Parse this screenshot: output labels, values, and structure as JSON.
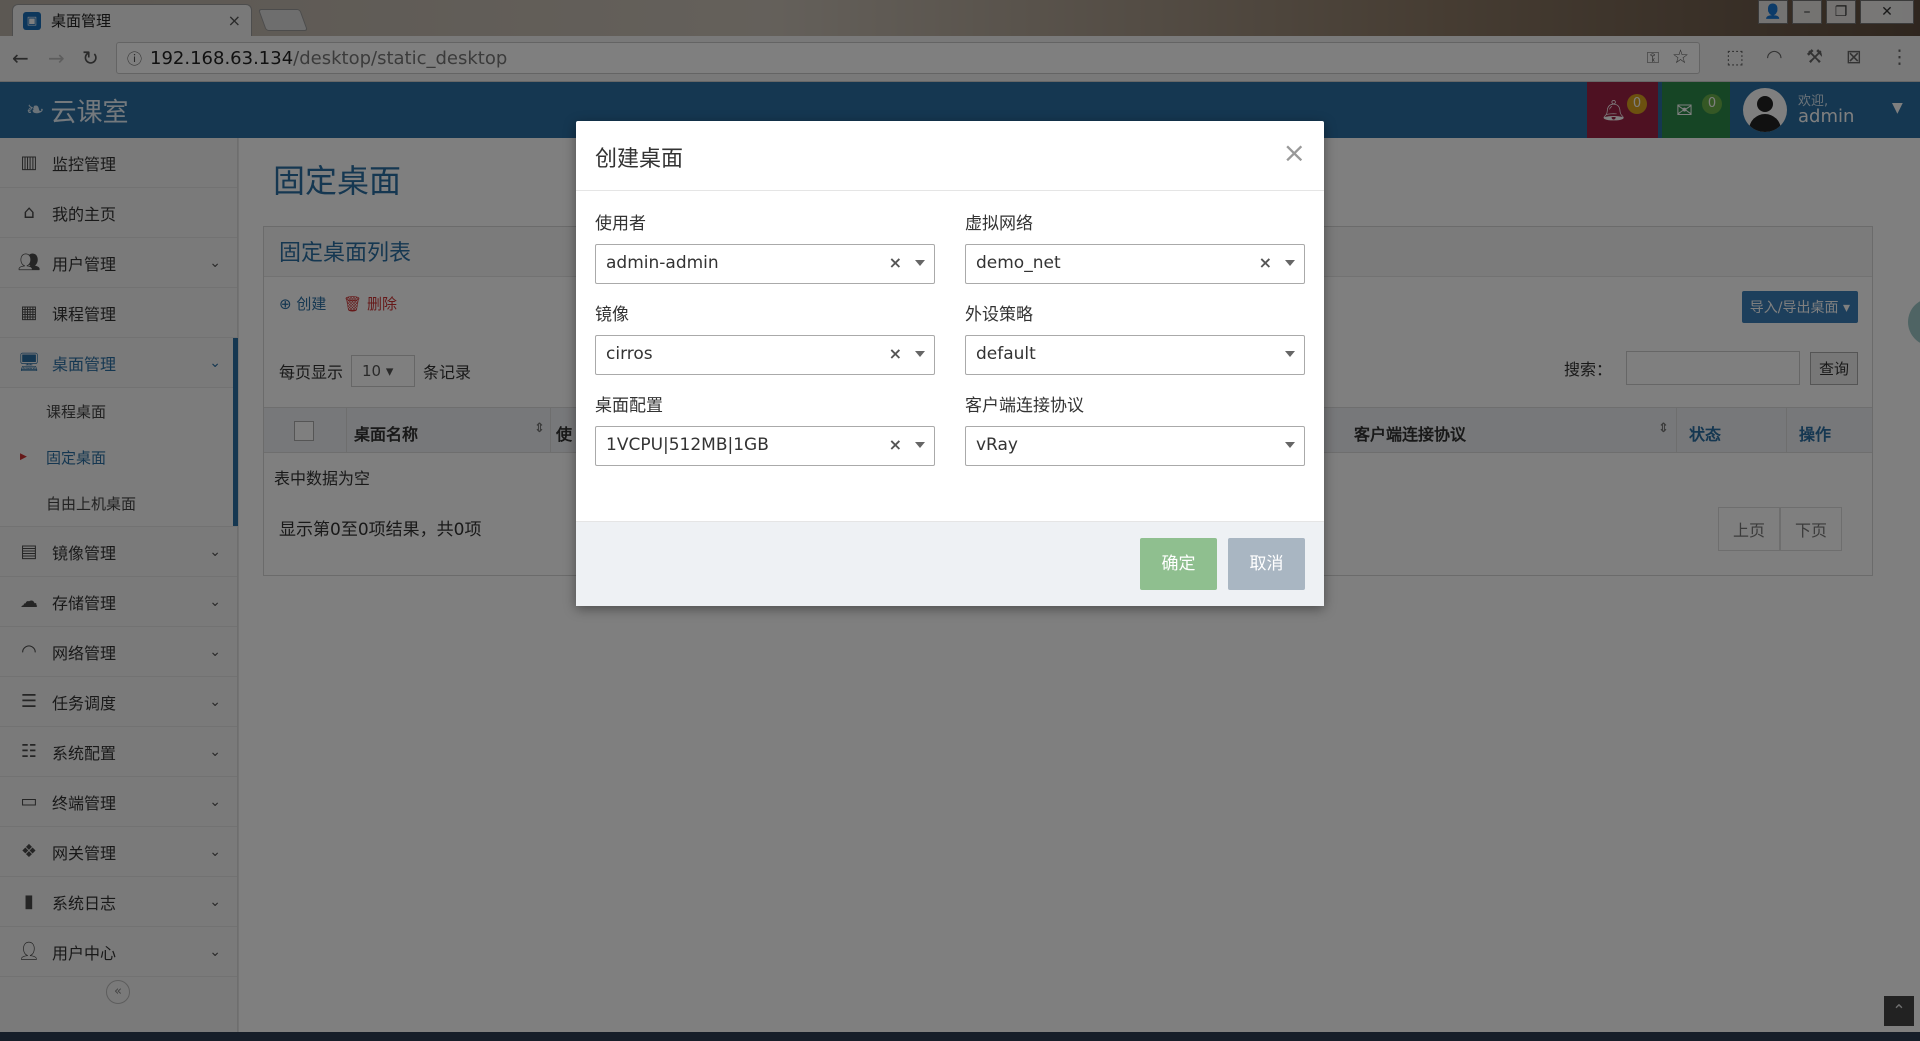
{
  "browser": {
    "tab_title": "桌面管理",
    "tab_close": "×",
    "url_host": "192.168.63.134",
    "url_path": "/desktop/static_desktop"
  },
  "header": {
    "brand": "云课室",
    "notifications_count": "0",
    "messages_count": "0",
    "welcome": "欢迎,",
    "username": "admin"
  },
  "sidebar": {
    "items": [
      {
        "label": "监控管理",
        "icon": "bar-chart-icon"
      },
      {
        "label": "我的主页",
        "icon": "home-icon"
      },
      {
        "label": "用户管理",
        "icon": "users-icon"
      },
      {
        "label": "课程管理",
        "icon": "calendar-icon"
      },
      {
        "label": "桌面管理",
        "icon": "desktop-icon"
      },
      {
        "label": "镜像管理",
        "icon": "film-icon"
      },
      {
        "label": "存储管理",
        "icon": "cloud-icon"
      },
      {
        "label": "网络管理",
        "icon": "wifi-icon"
      },
      {
        "label": "任务调度",
        "icon": "list-icon"
      },
      {
        "label": "系统配置",
        "icon": "sliders-icon"
      },
      {
        "label": "终端管理",
        "icon": "laptop-icon"
      },
      {
        "label": "网关管理",
        "icon": "cubes-icon"
      },
      {
        "label": "系统日志",
        "icon": "book-icon"
      },
      {
        "label": "用户中心",
        "icon": "user-icon"
      }
    ],
    "submenu": [
      "课程桌面",
      "固定桌面",
      "自由上机桌面"
    ],
    "collapse": "«"
  },
  "page": {
    "title": "固定桌面",
    "panel_title": "固定桌面列表",
    "create": "创建",
    "delete": "删除",
    "import_export": "导入/导出桌面 ▾",
    "per_page_prefix": "每页显示",
    "per_page_value": "10",
    "per_page_suffix": "条记录",
    "search_label": "搜索：",
    "search_button": "查询",
    "columns": [
      "桌面名称",
      "使",
      "客户端连接协议",
      "状态",
      "操作"
    ],
    "empty_text": "表中数据为空",
    "info_text": "显示第0至0项结果，共0项",
    "prev": "上页",
    "next": "下页"
  },
  "modal": {
    "title": "创建桌面",
    "close": "×",
    "fields": {
      "user": {
        "label": "使用者",
        "value": "admin-admin"
      },
      "network": {
        "label": "虚拟网络",
        "value": "demo_net"
      },
      "image": {
        "label": "镜像",
        "value": "cirros"
      },
      "peripheral": {
        "label": "外设策略",
        "value": "default"
      },
      "config": {
        "label": "桌面配置",
        "value": "1VCPU|512MB|1GB"
      },
      "protocol": {
        "label": "客户端连接协议",
        "value": "vRay"
      }
    },
    "ok": "确定",
    "cancel": "取消"
  },
  "colors": {
    "brand_blue": "#2b6fa3",
    "bell_red": "#9c2345",
    "mail_green": "#2d8b4a",
    "ok_green": "#8fbf8f",
    "cancel_gray": "#a9b6c2"
  }
}
